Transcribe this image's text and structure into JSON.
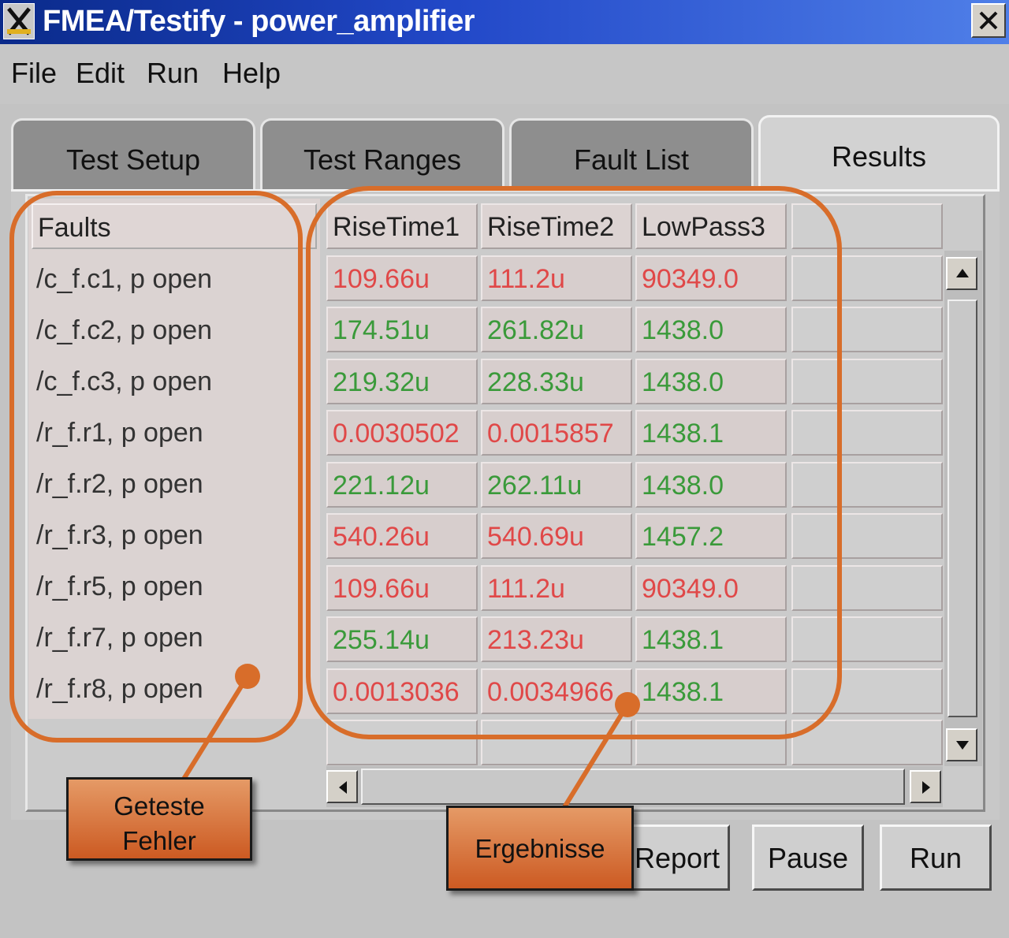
{
  "window": {
    "title": "FMEA/Testify - power_amplifier"
  },
  "menu": [
    "File",
    "Edit",
    "Run",
    "Help"
  ],
  "tabs": [
    "Test Setup",
    "Test Ranges",
    "Fault List",
    "Results"
  ],
  "table": {
    "fault_header": "Faults",
    "columns": [
      "RiseTime1",
      "RiseTime2",
      "LowPass3"
    ],
    "rows": [
      {
        "fault": "/c_f.c1, p open",
        "values": [
          "109.66u",
          "111.2u",
          "90349.0"
        ],
        "status": [
          "red",
          "red",
          "red"
        ]
      },
      {
        "fault": "/c_f.c2, p open",
        "values": [
          "174.51u",
          "261.82u",
          "1438.0"
        ],
        "status": [
          "green",
          "green",
          "green"
        ]
      },
      {
        "fault": "/c_f.c3, p open",
        "values": [
          "219.32u",
          "228.33u",
          "1438.0"
        ],
        "status": [
          "green",
          "green",
          "green"
        ]
      },
      {
        "fault": "/r_f.r1, p open",
        "values": [
          "0.0030502",
          "0.0015857",
          "1438.1"
        ],
        "status": [
          "red",
          "red",
          "green"
        ]
      },
      {
        "fault": "/r_f.r2, p open",
        "values": [
          "221.12u",
          "262.11u",
          "1438.0"
        ],
        "status": [
          "green",
          "green",
          "green"
        ]
      },
      {
        "fault": "/r_f.r3, p open",
        "values": [
          "540.26u",
          "540.69u",
          "1457.2"
        ],
        "status": [
          "red",
          "red",
          "green"
        ]
      },
      {
        "fault": "/r_f.r5, p open",
        "values": [
          "109.66u",
          "111.2u",
          "90349.0"
        ],
        "status": [
          "red",
          "red",
          "red"
        ]
      },
      {
        "fault": "/r_f.r7, p open",
        "values": [
          "255.14u",
          "213.23u",
          "1438.1"
        ],
        "status": [
          "green",
          "red",
          "green"
        ]
      },
      {
        "fault": "/r_f.r8, p open",
        "values": [
          "0.0013036",
          "0.0034966",
          "1438.1"
        ],
        "status": [
          "red",
          "red",
          "green"
        ]
      }
    ]
  },
  "buttons": {
    "report": "Report",
    "pause": "Pause",
    "run": "Run"
  },
  "annotations": {
    "faults_label_line1": "Geteste",
    "faults_label_line2": "Fehler",
    "results_label": "Ergebnisse"
  },
  "colors": {
    "fail": "#e04848",
    "pass": "#3a9a3a",
    "annotation": "#d86d2a"
  }
}
